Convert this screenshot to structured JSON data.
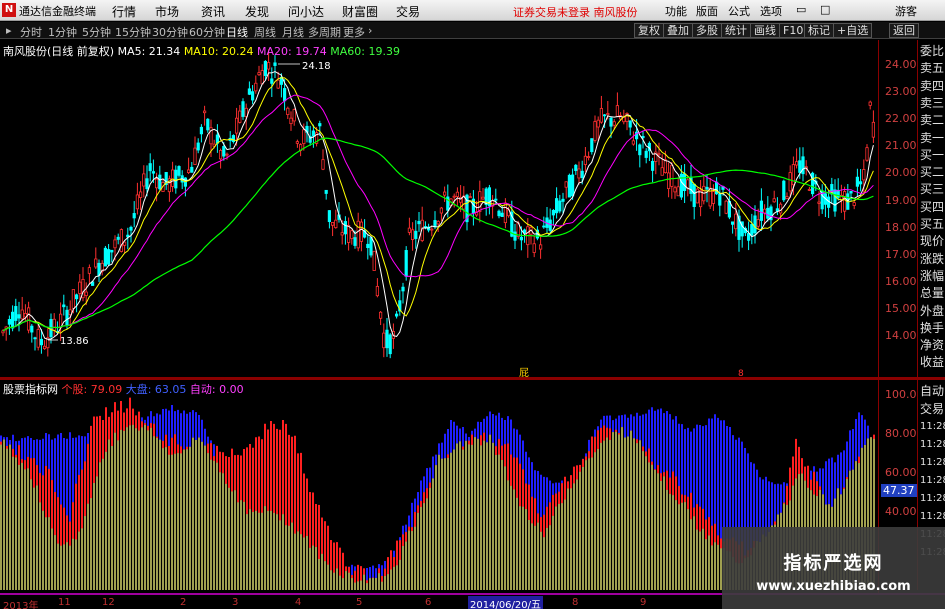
{
  "app": {
    "title": "通达信金融终端",
    "logo": "N"
  },
  "menu": [
    "行情",
    "市场",
    "资讯",
    "发现",
    "问小达",
    "财富圈",
    "交易"
  ],
  "notice": "证券交易未登录  南风股份",
  "right_menu": [
    "功能",
    "版面",
    "公式",
    "选项"
  ],
  "guest": "游客",
  "periods": [
    "分时",
    "1分钟",
    "5分钟",
    "15分钟",
    "30分钟",
    "60分钟",
    "日线",
    "周线",
    "月线",
    "多周期",
    "更多"
  ],
  "tool_buttons": [
    "复权",
    "叠加",
    "多股",
    "统计",
    "画线",
    "F10",
    "标记",
    "+自选",
    "返回"
  ],
  "main_legend": {
    "stock": "南风股份(日线 前复权)",
    "ma5": "MA5: 21.34",
    "ma10": "MA10: 20.24",
    "ma20": "MA20: 19.74",
    "ma60": "MA60: 19.39"
  },
  "sub_legend": {
    "name": "股票指标网",
    "gegu": "个股: 79.09",
    "dapan": "大盘: 63.05",
    "zidong": "自动: 0.00"
  },
  "price_ticks": [
    "24.00",
    "23.00",
    "22.00",
    "21.00",
    "20.00",
    "19.00",
    "18.00",
    "17.00",
    "16.00",
    "15.00",
    "14.00"
  ],
  "sub_ticks": [
    "100.0",
    "80.00",
    "60.00",
    "40.00"
  ],
  "sub_value_box": "47.37",
  "high_label": "24.18",
  "low_label": "13.86",
  "quote_labels": [
    "委比",
    "卖五",
    "卖四",
    "卖三",
    "卖二",
    "卖一",
    "买一",
    "买二",
    "买三",
    "买四",
    "买五",
    "现价",
    "涨跌",
    "涨幅",
    "总量",
    "外盘",
    "换手",
    "净资",
    "收益"
  ],
  "sub_right_labels": [
    "自动",
    "交易",
    "11:28",
    "11:28",
    "11:28",
    "11:28",
    "11:28",
    "11:28",
    "11:28",
    "11:28"
  ],
  "timeline": {
    "labels": [
      "2013年",
      "11",
      "12",
      "2",
      "3",
      "4",
      "5",
      "6",
      "8",
      "9"
    ],
    "date": "2014/06/20/五"
  },
  "markers": {
    "chip1": "屁",
    "chip2": "8"
  },
  "watermark": {
    "title": "指标严选网",
    "url": "www.xuezhibiao.com"
  },
  "colors": {
    "ma5": "#ffffff",
    "ma10": "#ffff00",
    "ma20": "#ff00ff",
    "ma60": "#00ff00",
    "up": "#ff3030",
    "down": "#00ffff",
    "gegu": "#ff2020",
    "dapan": "#2020ff",
    "fill": "#a0a050"
  }
}
